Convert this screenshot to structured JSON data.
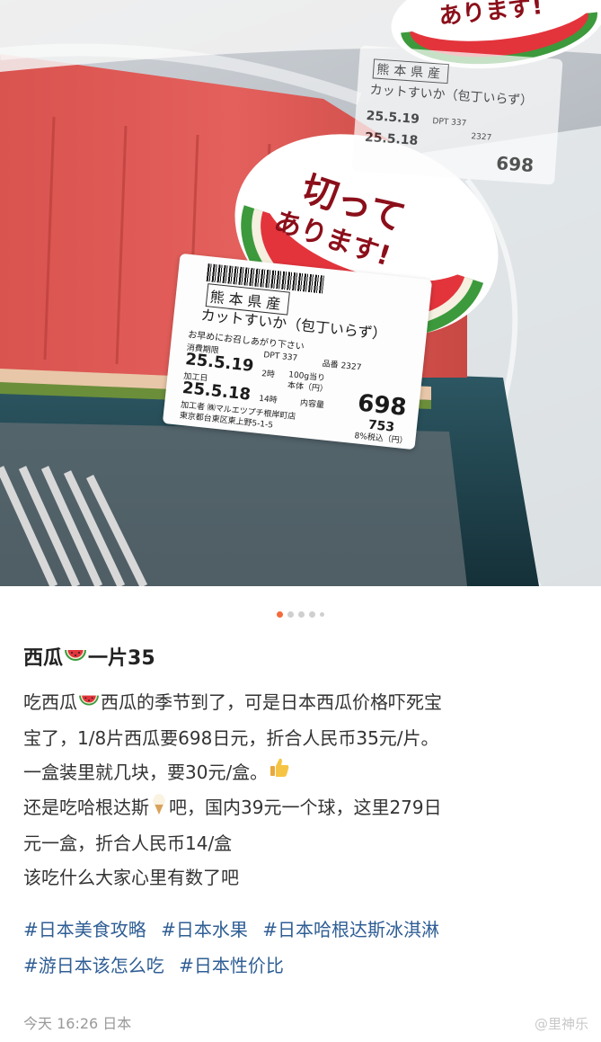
{
  "photo": {
    "sticker_top_text": "ありまず!",
    "sticker_line1": "切って",
    "sticker_line2": "あります!",
    "main_tag": {
      "origin": "熊本県産",
      "product": "カットすいか（包丁いらず）",
      "note": "お早めにお召しあがり下さい",
      "expiry_label": "消費期限",
      "expiry_date": "25.5.19",
      "dpt": "DPT 337",
      "code": "品番 2327",
      "hour1": "2時",
      "per100": "100g当り",
      "base_label": "本体（円）",
      "processed_label": "加工日",
      "processed_date": "25.5.18",
      "hour2": "14時",
      "content_label": "内容量",
      "price": "698",
      "processor": "加工者 ㈱マルエツプチ根岸町店",
      "address": "東京都台東区東上野5-1-5",
      "tax_label": "8%税込（円）",
      "tax_price": "753"
    },
    "back_tag": {
      "origin": "熊本県産",
      "product": "カットすいか（包丁いらず）",
      "expiry_date": "25.5.19",
      "processed_date": "25.5.18",
      "dpt": "DPT 337",
      "code": "2327",
      "price": "698"
    }
  },
  "carousel": {
    "count": 5,
    "active_index": 0
  },
  "post": {
    "title_a": "西瓜",
    "title_b": "一片35",
    "body": {
      "l1a": "吃西瓜",
      "l1b": "西瓜的季节到了，可是日本西瓜价格吓死宝",
      "l2": "宝了，1/8片西瓜要698日元，折合人民币35元/片。",
      "l3": "一盒装里就几块，要30元/盒。",
      "l4a": "还是吃哈根达斯",
      "l4b": "吧，国内39元一个球，这里279日",
      "l5": "元一盒，折合人民币14/盒",
      "l6": "该吃什么大家心里有数了吧"
    },
    "hashtags": [
      "#日本美食攻略",
      "#日本水果",
      "#日本哈根达斯冰淇淋",
      "#游日本该怎么吃",
      "#日本性价比"
    ],
    "time": "今天 16:26",
    "location": "日本",
    "watermark": "@里神乐"
  },
  "emoji_icons": [
    "watermelon-icon",
    "thumbs-up-icon",
    "ice-cream-icon"
  ],
  "colors": {
    "hashtag": "#2f5e95",
    "active_dot": "#f56a3a"
  }
}
